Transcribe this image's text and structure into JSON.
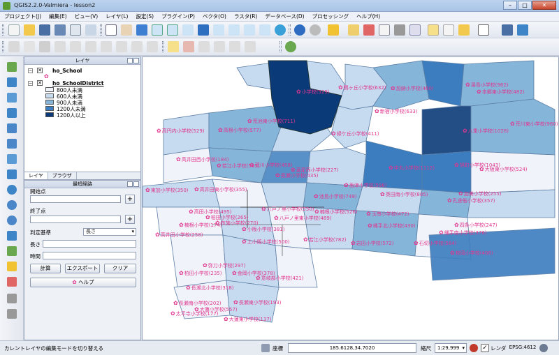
{
  "window": {
    "title": "QGIS2.2.0-Valmiera - lesson2",
    "minimize": "–",
    "maximize": "□",
    "close": "✕"
  },
  "menu": [
    "プロジェクト(J)",
    "編集(E)",
    "ビュー(V)",
    "レイヤ(L)",
    "設定(S)",
    "プラグイン(P)",
    "ベクタ(O)",
    "ラスタ(R)",
    "データベース(D)",
    "プロセッシング",
    "ヘルプ(H)"
  ],
  "layers_panel": {
    "title": "レイヤ",
    "layer1": "ho_School",
    "layer2": "ho_SchoolDistrict",
    "legend": [
      {
        "label": "800人未満",
        "color": "#f0f4fa"
      },
      {
        "label": "600人未満",
        "color": "#c6dbef"
      },
      {
        "label": "900人未満",
        "color": "#85b6da"
      },
      {
        "label": "1200人未満",
        "color": "#3b7dbf"
      },
      {
        "label": "1200人以上",
        "color": "#0b3a78"
      }
    ],
    "tabs": [
      "レイヤ",
      "ブラウザ"
    ]
  },
  "measure_panel": {
    "title": "最短経路",
    "start_label": "開始点",
    "end_label": "終了点",
    "criterion_label": "判定基準",
    "criterion_value": "長さ",
    "length_label": "長さ",
    "time_label": "時間",
    "calc_button": "計算",
    "export_button": "エクスポート",
    "clear_button": "クリア",
    "help_button": "ヘルプ"
  },
  "schools": [
    {
      "name": "小学校(529)"
    },
    {
      "name": "鶴ヶ丘小学校(632)"
    },
    {
      "name": "加納小学校(460)"
    },
    {
      "name": "湯島小学校(962)"
    },
    {
      "name": "本郷東小学校(482)"
    },
    {
      "name": "新宿小学校(633)"
    },
    {
      "name": "荒池東小学校(711)"
    },
    {
      "name": "高円内小学校(529)"
    },
    {
      "name": "高根小学校(577)"
    },
    {
      "name": "緑ケ丘小学校(411)"
    },
    {
      "name": "八重小学校(1028)"
    },
    {
      "name": "荒川東小学校(960)"
    },
    {
      "name": "高井田西小学校(184)"
    },
    {
      "name": "若江小学校(565)"
    },
    {
      "name": "荒川小学校(458)"
    },
    {
      "name": "菱屋西小学校(227)"
    },
    {
      "name": "中丸小学校(1112)"
    },
    {
      "name": "旭町小学校(1043)"
    },
    {
      "name": "大阪東小学校(524)"
    },
    {
      "name": "長瀬小学校(435)"
    },
    {
      "name": "東加小学校(350)"
    },
    {
      "name": "高井田東小学校(355)"
    },
    {
      "name": "盾津小学校(598)"
    },
    {
      "name": "池島小学校(749)"
    },
    {
      "name": "英田南小学校(805)"
    },
    {
      "name": "加美小学校(255)"
    },
    {
      "name": "孔舎衙小学校(357)"
    },
    {
      "name": "高田小学校(495)"
    },
    {
      "name": "柏田小学校(265)"
    },
    {
      "name": "八戸ノ里小学校(550)"
    },
    {
      "name": "八戸ノ里東小学校(489)"
    },
    {
      "name": "楠根小学校(526)"
    },
    {
      "name": "玉串小学校(472)"
    },
    {
      "name": "楠根小学校(174)"
    },
    {
      "name": "縄手北小学校(430)"
    },
    {
      "name": "四条小学校(247)"
    },
    {
      "name": "布施小学校(270)"
    },
    {
      "name": "小阪小学校(381)"
    },
    {
      "name": "縄手南小学校(376)"
    },
    {
      "name": "上小阪小学校(500)"
    },
    {
      "name": "若江小学校(782)"
    },
    {
      "name": "岩田小学校(572)"
    },
    {
      "name": "石切小学校(564)"
    },
    {
      "name": "枚岡小学校(408)"
    },
    {
      "name": "高井田小学校(258)"
    },
    {
      "name": "弥刀小学校(297)"
    },
    {
      "name": "柏田小学校(235)"
    },
    {
      "name": "金岡小学校(378)"
    },
    {
      "name": "意岐部小学校(421)"
    },
    {
      "name": "長瀬北小学校(318)"
    },
    {
      "name": "長瀬南小学校(202)"
    },
    {
      "name": "長瀬東小学校(193)"
    },
    {
      "name": "大蓮小学校(557)"
    },
    {
      "name": "太平寺小学校(177)"
    },
    {
      "name": "大蓮東小学校(137)"
    }
  ],
  "status": {
    "message": "カレントレイヤの編集モードを切り替える",
    "coord_label": "座標",
    "coord_value": "185.6128,34.7020",
    "scale_label": "縮尺",
    "scale_value": "1:29,999",
    "render_label": "レンダ",
    "crs": "EPSG:4612"
  }
}
